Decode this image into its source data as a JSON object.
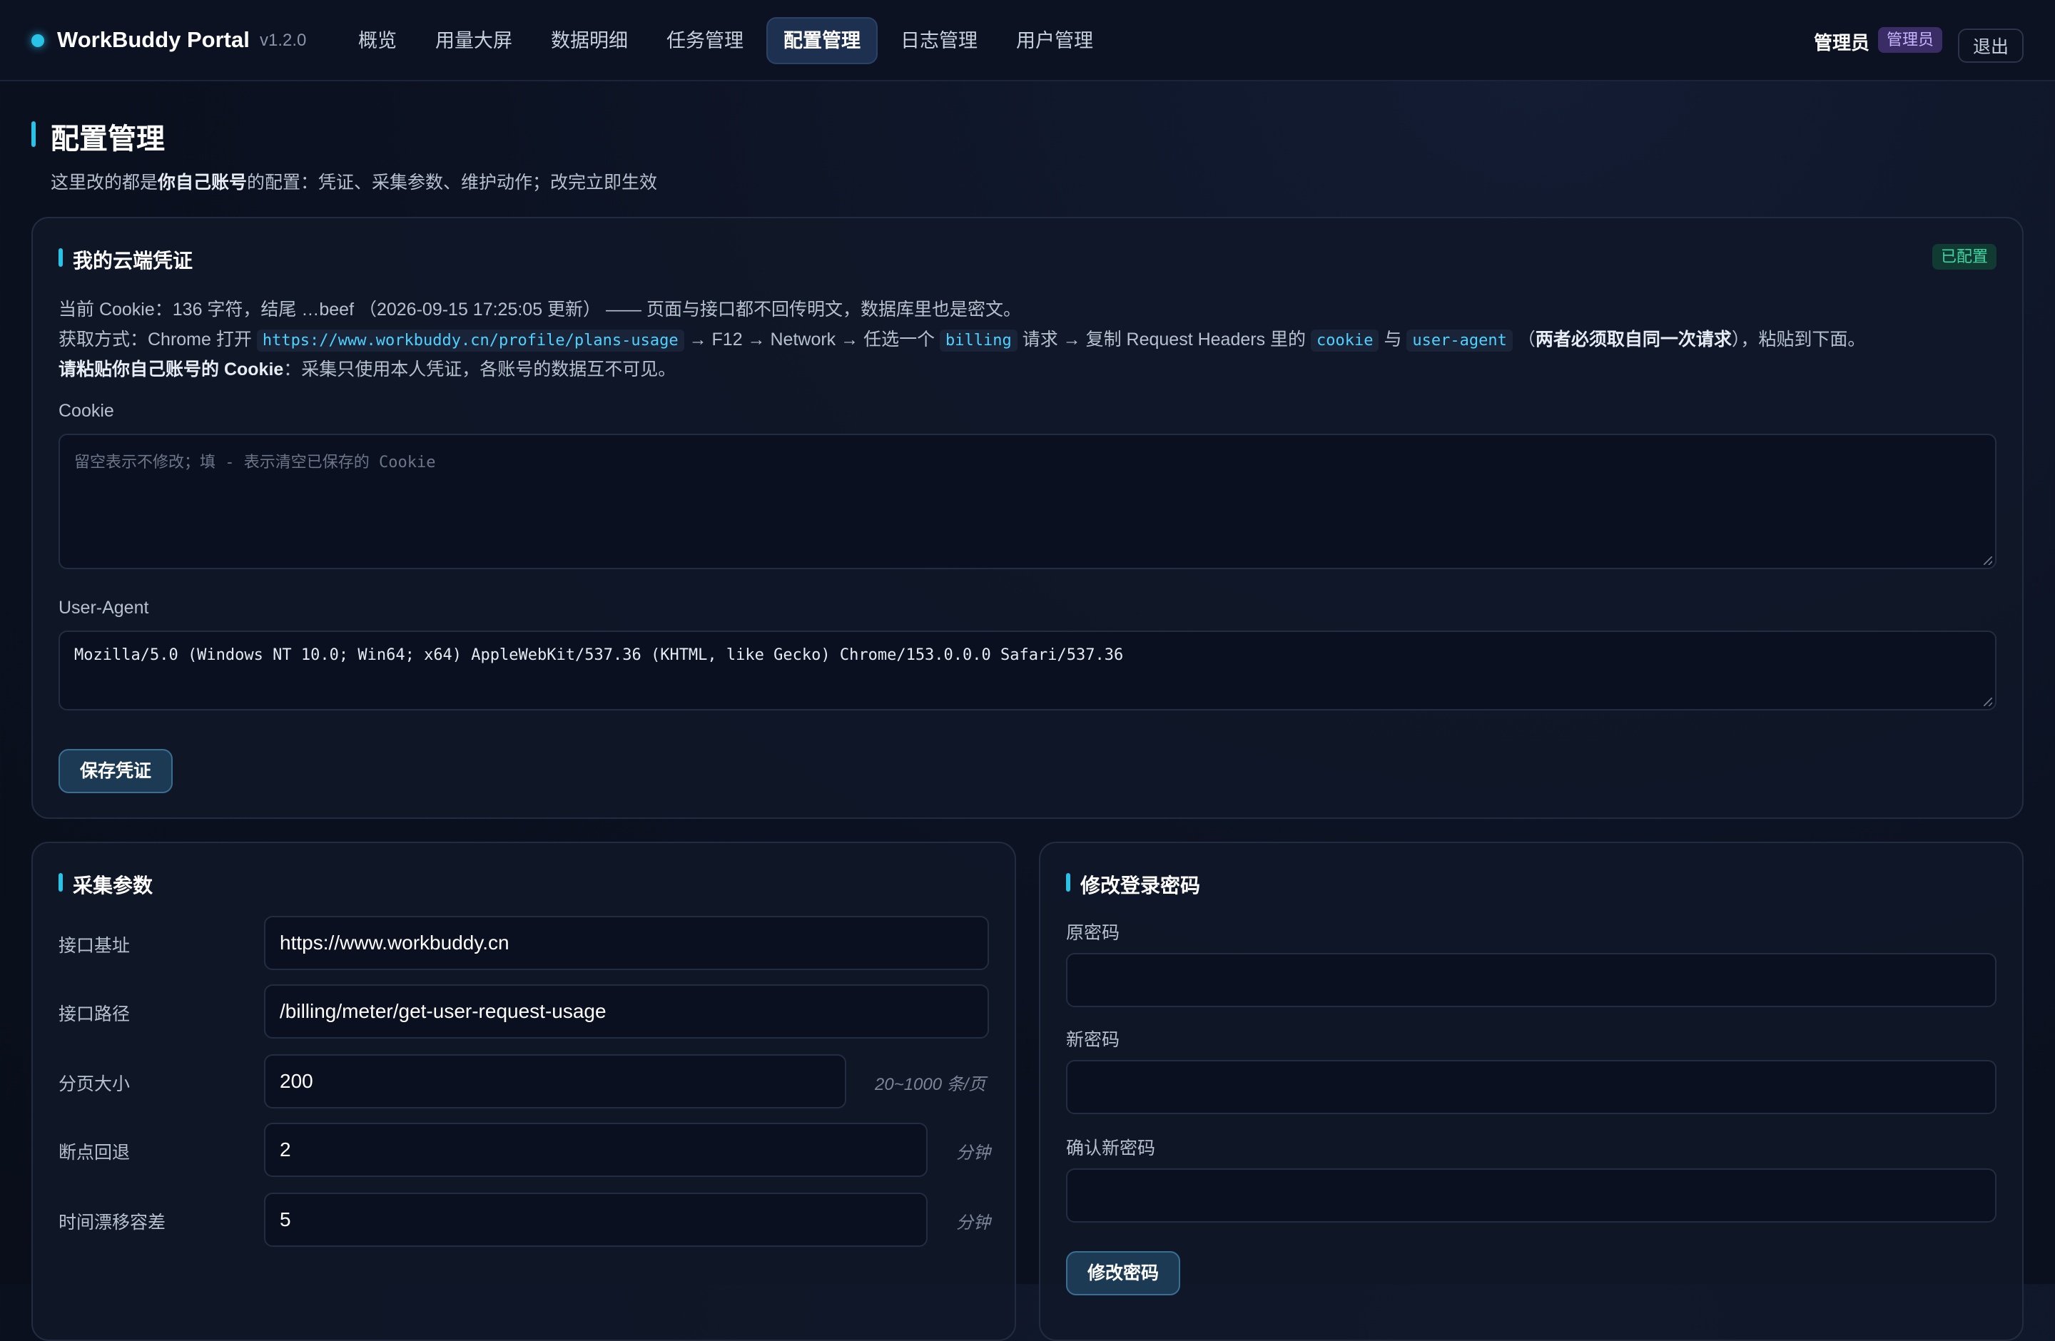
{
  "header": {
    "brand": "WorkBuddy Portal",
    "version": "v1.2.0",
    "nav": [
      "概览",
      "用量大屏",
      "数据明细",
      "任务管理",
      "配置管理",
      "日志管理",
      "用户管理"
    ],
    "active_nav": "配置管理",
    "user": "管理员",
    "role": "管理员",
    "logout": "退出"
  },
  "page": {
    "title": "配置管理",
    "subtitle_pre": "这里改的都是",
    "subtitle_bold": "你自己账号",
    "subtitle_post": "的配置：凭证、采集参数、维护动作；改完立即生效"
  },
  "credentials": {
    "title": "我的云端凭证",
    "status": "已配置",
    "line1": "当前 Cookie：136 字符，结尾 …beef （2026-09-15 17:25:05 更新） —— 页面与接口都不回传明文，数据库里也是密文。",
    "line2_a": "获取方式：Chrome 打开",
    "line2_url": "https://www.workbuddy.cn/profile/plans-usage",
    "line2_b": "→ F12 → Network → 任选一个",
    "line2_code1": "billing",
    "line2_c": "请求 → 复制 Request Headers 里的",
    "line2_code2": "cookie",
    "line2_d": "与",
    "line2_code3": "user-agent",
    "line2_e": "（",
    "line2_bold": "两者必须取自同一次请求",
    "line2_f": "），粘贴到下面。",
    "line3_bold": "请粘贴你自己账号的 Cookie",
    "line3_rest": "：采集只使用本人凭证，各账号的数据互不可见。",
    "cookie_label": "Cookie",
    "cookie_placeholder": "留空表示不修改；填 - 表示清空已保存的 Cookie",
    "ua_label": "User-Agent",
    "ua_value": "Mozilla/5.0 (Windows NT 10.0; Win64; x64) AppleWebKit/537.36 (KHTML, like Gecko) Chrome/153.0.0.0 Safari/537.36",
    "save_button": "保存凭证"
  },
  "collect": {
    "title": "采集参数",
    "rows": [
      {
        "label": "接口基址",
        "value": "https://www.workbuddy.cn",
        "unit": ""
      },
      {
        "label": "接口路径",
        "value": "/billing/meter/get-user-request-usage",
        "unit": ""
      },
      {
        "label": "分页大小",
        "value": "200",
        "unit": "20~1000 条/页"
      },
      {
        "label": "断点回退",
        "value": "2",
        "unit": "分钟"
      },
      {
        "label": "时间漂移容差",
        "value": "5",
        "unit": "分钟"
      }
    ]
  },
  "password": {
    "title": "修改登录密码",
    "old_label": "原密码",
    "new_label": "新密码",
    "confirm_label": "确认新密码",
    "submit": "修改密码"
  }
}
